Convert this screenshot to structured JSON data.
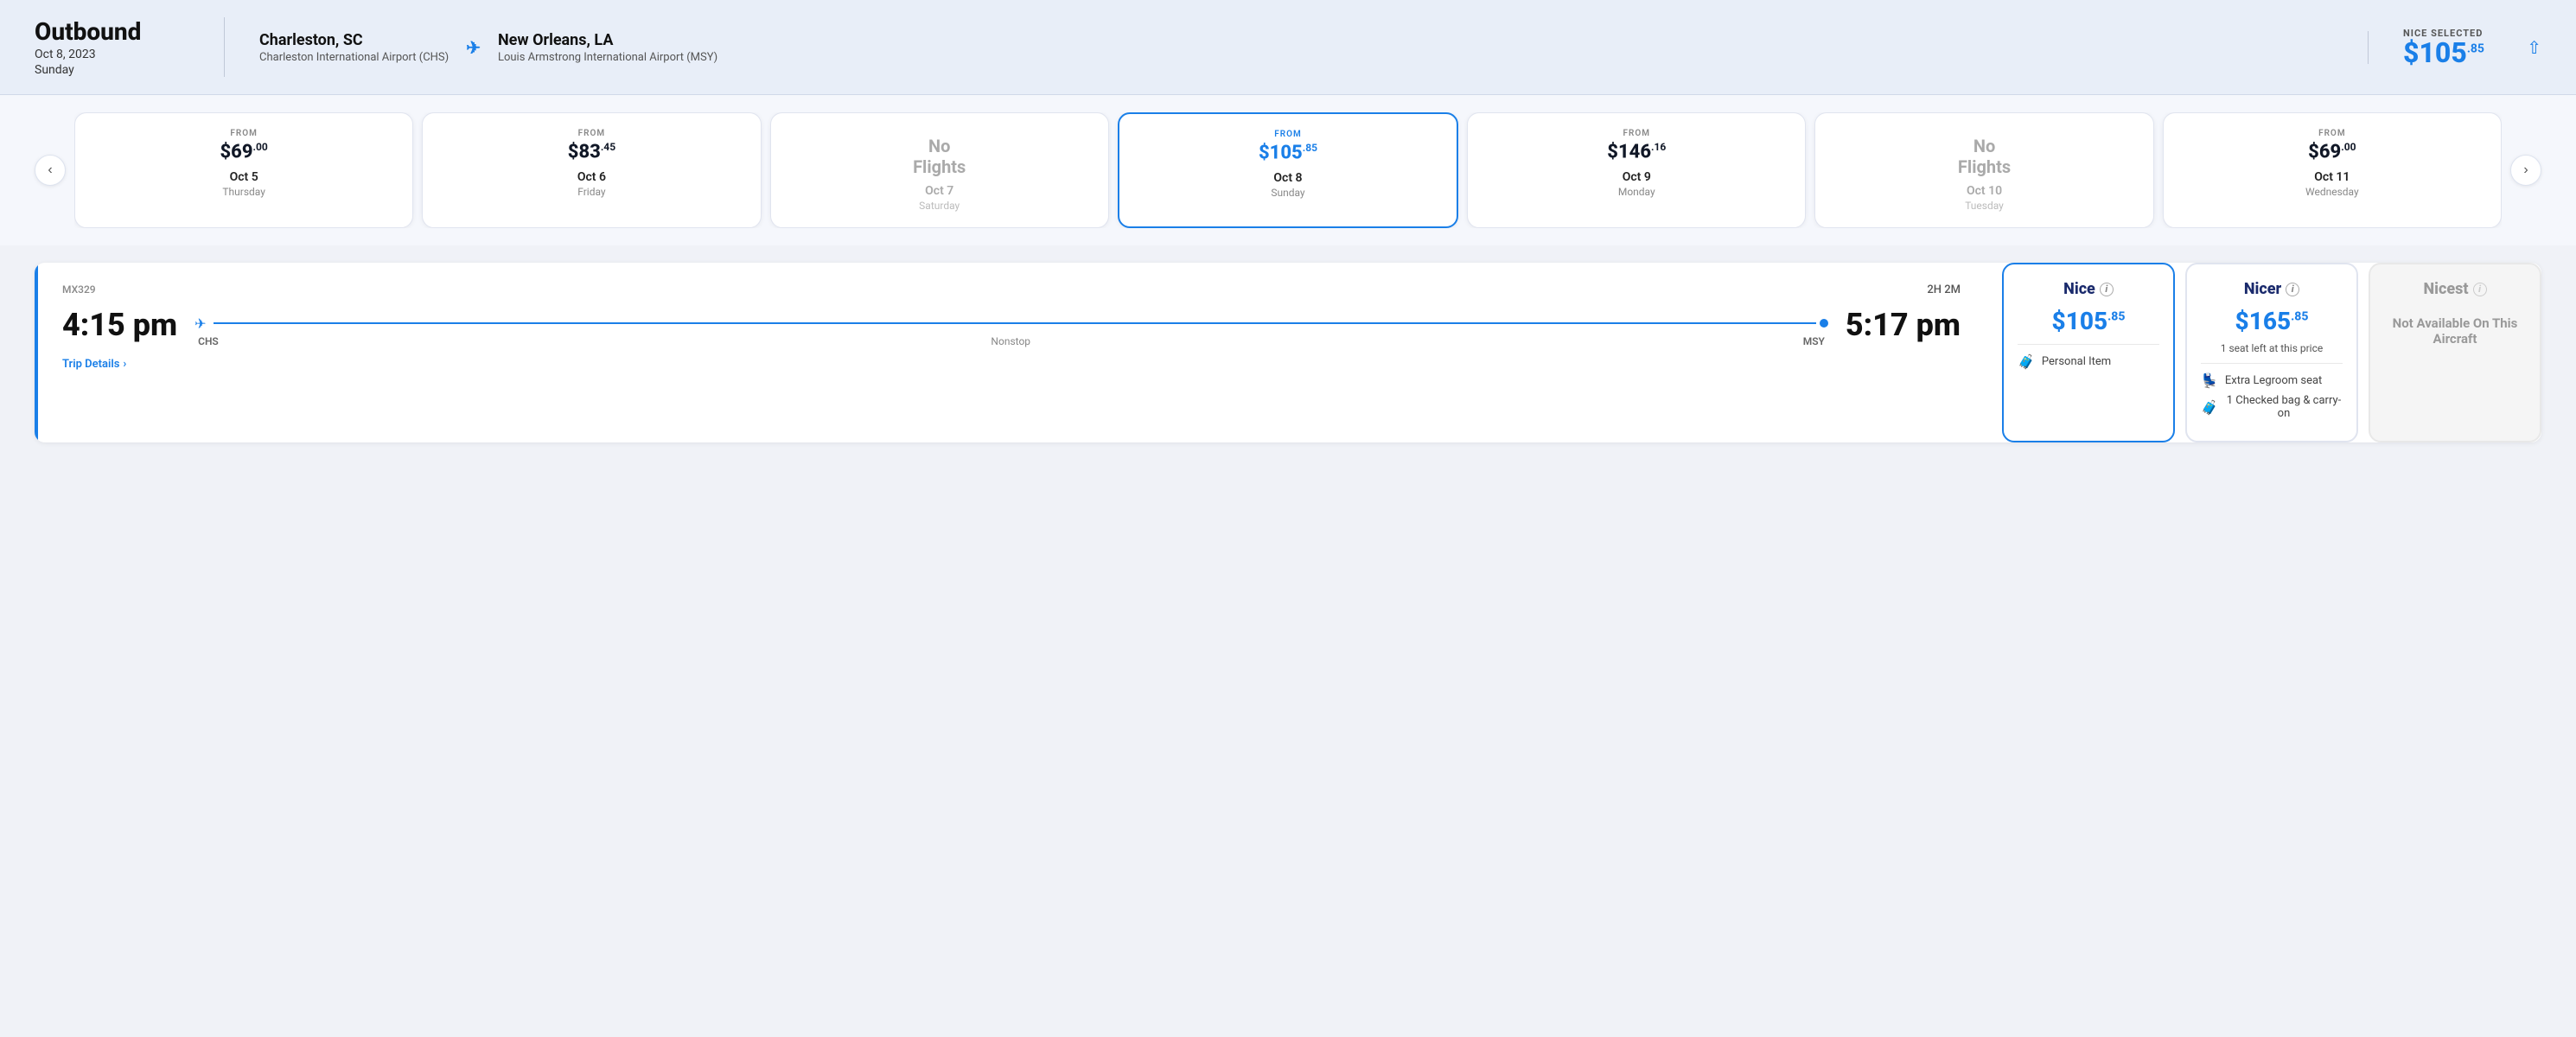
{
  "header": {
    "title": "Outbound",
    "date": "Oct 8, 2023",
    "day": "Sunday",
    "origin": {
      "city": "Charleston, SC",
      "airport": "Charleston International Airport (CHS)"
    },
    "destination": {
      "city": "New Orleans, LA",
      "airport": "Louis Armstrong International Airport (MSY)"
    },
    "selected_fare_label": "NICE SELECTED",
    "selected_price_whole": "$105",
    "selected_price_cents": ".85"
  },
  "date_cards": [
    {
      "type": "price",
      "from_label": "FROM",
      "price_whole": "$69",
      "price_cents": ".00",
      "date": "Oct 5",
      "weekday": "Thursday",
      "selected": false
    },
    {
      "type": "price",
      "from_label": "FROM",
      "price_whole": "$83",
      "price_cents": ".45",
      "date": "Oct 6",
      "weekday": "Friday",
      "selected": false
    },
    {
      "type": "no_flights",
      "no_flights_text": "No Flights",
      "date": "Oct 7",
      "weekday": "Saturday",
      "selected": false
    },
    {
      "type": "price",
      "from_label": "FROM",
      "price_whole": "$105",
      "price_cents": ".85",
      "date": "Oct 8",
      "weekday": "Sunday",
      "selected": true
    },
    {
      "type": "price",
      "from_label": "FROM",
      "price_whole": "$146",
      "price_cents": ".16",
      "date": "Oct 9",
      "weekday": "Monday",
      "selected": false
    },
    {
      "type": "no_flights",
      "no_flights_text": "No Flights",
      "date": "Oct 10",
      "weekday": "Tuesday",
      "selected": false
    },
    {
      "type": "price",
      "from_label": "FROM",
      "price_whole": "$69",
      "price_cents": ".00",
      "date": "Oct 11",
      "weekday": "Wednesday",
      "selected": false
    }
  ],
  "flight": {
    "code": "MX329",
    "duration": "2H 2M",
    "depart_time": "4:15 pm",
    "arrive_time": "5:17 pm",
    "origin_code": "CHS",
    "dest_code": "MSY",
    "stop_label": "Nonstop",
    "trip_details": "Trip Details"
  },
  "fare_cards": [
    {
      "id": "nice",
      "title": "Nice",
      "price_whole": "$105",
      "price_cents": ".85",
      "seat_note": "",
      "features": [
        {
          "icon": "🧳",
          "text": "Personal Item"
        }
      ],
      "selected": true,
      "available": true
    },
    {
      "id": "nicer",
      "title": "Nicer",
      "price_whole": "$165",
      "price_cents": ".85",
      "seat_note": "1 seat left at this price",
      "features": [
        {
          "icon": "💺",
          "text": "Extra Legroom seat"
        },
        {
          "icon": "🧳",
          "text": "1 Checked bag & carry-on"
        }
      ],
      "selected": false,
      "available": true
    },
    {
      "id": "nicest",
      "title": "Nicest",
      "price_whole": "",
      "price_cents": "",
      "seat_note": "",
      "features": [],
      "selected": false,
      "available": false,
      "unavailable_text": "Not Available On This Aircraft"
    }
  ],
  "nav": {
    "prev_label": "‹",
    "next_label": "›"
  }
}
